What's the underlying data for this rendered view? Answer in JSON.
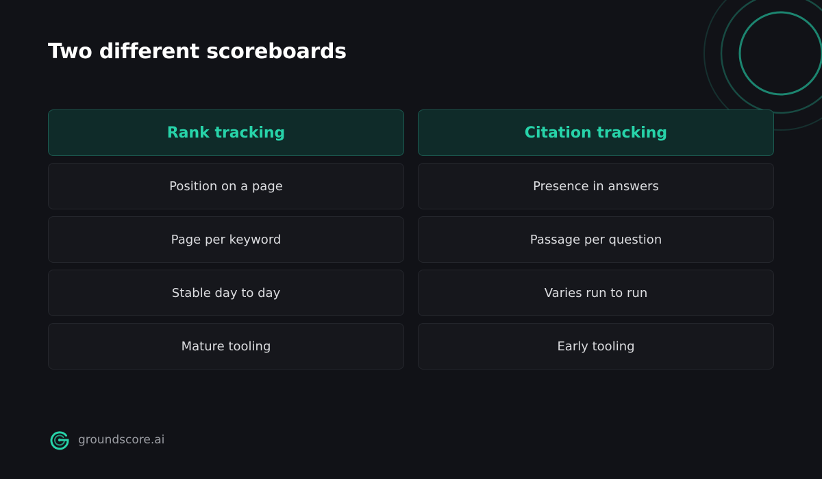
{
  "title": "Two different scoreboards",
  "columns": [
    {
      "header": "Rank tracking",
      "rows": [
        "Position on a page",
        "Page per keyword",
        "Stable day to day",
        "Mature tooling"
      ]
    },
    {
      "header": "Citation tracking",
      "rows": [
        "Presence in answers",
        "Passage per question",
        "Varies run to run",
        "Early tooling"
      ]
    }
  ],
  "footer": {
    "logo_icon": "g-circle-logo-icon",
    "brand": "groundscore.ai"
  },
  "decoration_icon": "concentric-arcs-icon",
  "colors": {
    "background": "#111217",
    "accent": "#27d3a9",
    "header_bg": "#0f2b29",
    "cell_bg": "#16171c"
  }
}
